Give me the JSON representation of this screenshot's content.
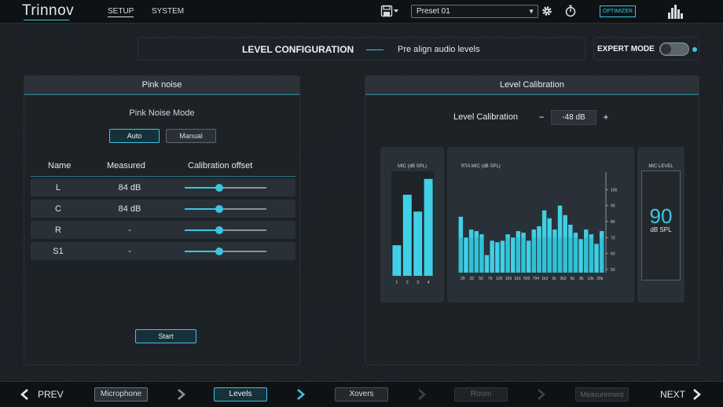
{
  "app": {
    "logo": "Trinnov"
  },
  "nav": {
    "setup": "SETUP",
    "system": "SYSTEM"
  },
  "header": {
    "preset": "Preset 01",
    "optimizer": "OPTIMIZER"
  },
  "level_config": {
    "title": "LEVEL CONFIGURATION",
    "subtitle": "Pre align audio levels"
  },
  "expert_mode": {
    "label": "EXPERT MODE",
    "enabled": false
  },
  "pink_noise": {
    "title": "Pink noise",
    "mode_label": "Pink Noise Mode",
    "auto": "Auto",
    "manual": "Manual",
    "selected_mode": "Auto",
    "columns": {
      "name": "Name",
      "measured": "Measured",
      "offset": "Calibration offset"
    },
    "rows": [
      {
        "name": "L",
        "measured": "84 dB",
        "offset": 0.42
      },
      {
        "name": "C",
        "measured": "84 dB",
        "offset": 0.42
      },
      {
        "name": "R",
        "measured": "-",
        "offset": 0.42
      },
      {
        "name": "S1",
        "measured": "-",
        "offset": 0.42
      }
    ],
    "start": "Start"
  },
  "level_calibration": {
    "title": "Level Calibration",
    "label": "Level Calibration",
    "value": "-48 dB",
    "minus": "−",
    "plus": "+",
    "mic_level": {
      "title": "MIC LEVEL",
      "value": "90",
      "unit": "dB SPL"
    }
  },
  "chart_data": [
    {
      "type": "bar",
      "title": "MIC (dB SPL)",
      "categories": [
        "1",
        "2",
        "3",
        "4"
      ],
      "values": [
        29,
        77,
        61,
        92
      ],
      "ylim": [
        0,
        100
      ]
    },
    {
      "type": "bar",
      "title": "RTA MIC (dB SPL)",
      "tick_labels": [
        "20",
        "32",
        "50",
        "79",
        "125",
        "199",
        "316",
        "500",
        "794",
        "1k3",
        "2k",
        "3k2",
        "5k",
        "8k",
        "13k",
        "20k"
      ],
      "values": [
        83,
        70,
        75,
        74,
        72,
        59,
        68,
        67,
        68,
        72,
        70,
        74,
        73,
        68,
        75,
        77,
        87,
        82,
        75,
        90,
        84,
        78,
        73,
        69,
        75,
        72,
        66,
        74
      ],
      "ytick_labels": [
        "100",
        "90",
        "80",
        "70",
        "60",
        "50"
      ],
      "yticks": [
        100,
        90,
        80,
        70,
        60,
        50
      ],
      "ylim": [
        48,
        108
      ]
    }
  ],
  "footer": {
    "prev": "PREV",
    "next": "NEXT",
    "steps": [
      "Microphone",
      "Levels",
      "Xovers",
      "Room",
      "Measurement"
    ]
  },
  "colors": {
    "accent": "#3bc6e0",
    "bar_fill": "#26b7cc",
    "bar_top": "#3fd0e6"
  },
  "icons": {
    "save": "save-icon",
    "settings": "gear-icon",
    "timer": "stopwatch-icon",
    "levels": "bar-meter-icon"
  }
}
